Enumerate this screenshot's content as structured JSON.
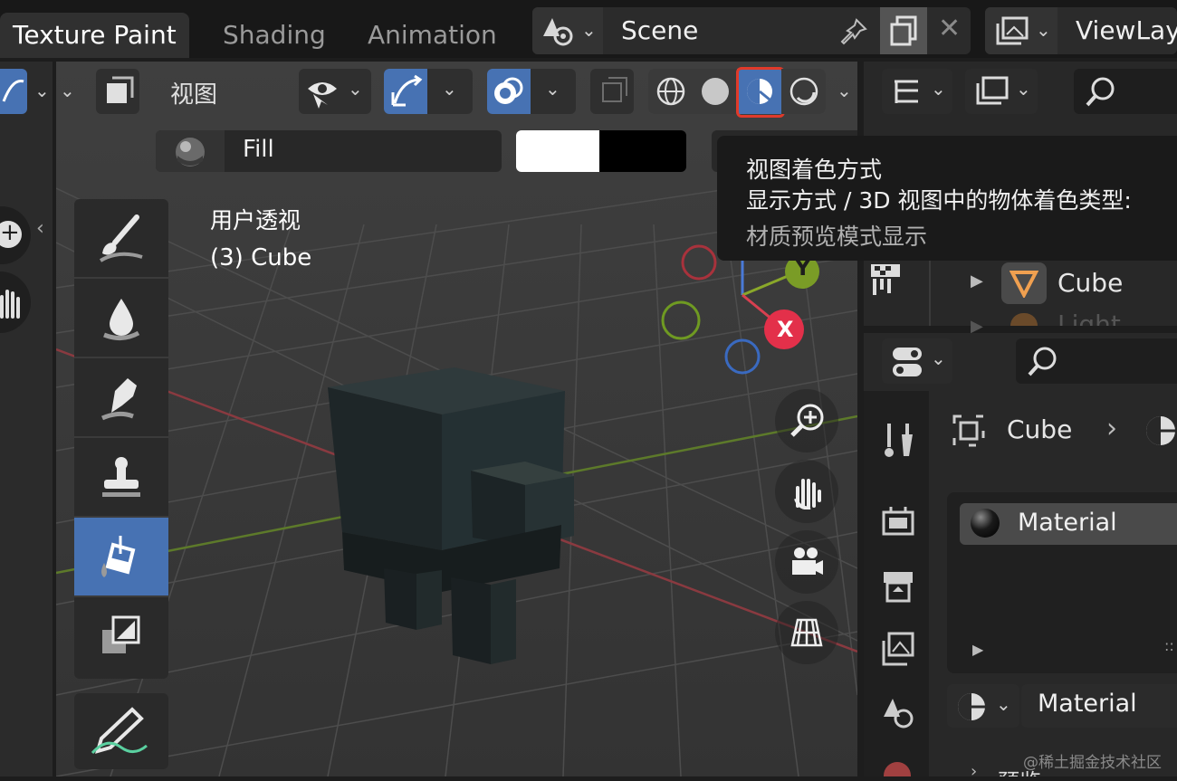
{
  "workspace_tabs": [
    {
      "label": "Texture Paint",
      "active": true
    },
    {
      "label": "Shading",
      "active": false
    },
    {
      "label": "Animation",
      "active": false
    }
  ],
  "scene": {
    "label": "Scene"
  },
  "view_layer": {
    "label": "ViewLay"
  },
  "viewport": {
    "menu_view": "视图",
    "fill_label": "Fill",
    "colors": {
      "primary": "#ffffff",
      "secondary": "#000000"
    },
    "perspective_label": "用户透视",
    "object_label": "(3) Cube",
    "gizmo": {
      "y": "Y",
      "x": "X"
    }
  },
  "tooltip": {
    "title": "视图着色方式",
    "description": "显示方式 / 3D 视图中的物体着色类型:",
    "value": "材质预览模式显示"
  },
  "outliner": {
    "item": "Cube",
    "item_partial": "Light"
  },
  "properties": {
    "breadcrumb_object": "Cube",
    "material_slot": "Material",
    "material_selector": "Material",
    "section_partial": "预览"
  },
  "watermark": "@稀土掘金技术社区",
  "accent_colors": {
    "selection": "#4772b3",
    "highlight_outline": "#e03a2a"
  }
}
